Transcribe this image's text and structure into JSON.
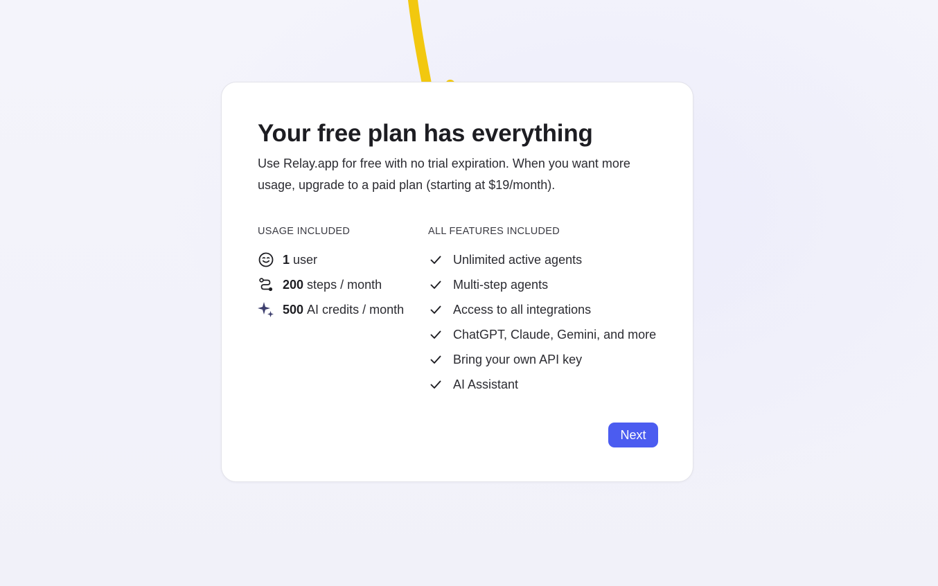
{
  "card": {
    "title": "Your free plan has everything",
    "subtitle": "Use Relay.app for free with no trial expiration. When you want more usage, upgrade to a paid plan (starting at $19/month)."
  },
  "usage": {
    "heading": "USAGE INCLUDED",
    "items": [
      {
        "icon": "smiley-face-icon",
        "number": "1",
        "text": "user"
      },
      {
        "icon": "workflow-steps-icon",
        "number": "200",
        "text": "steps / month"
      },
      {
        "icon": "sparkles-icon",
        "number": "500",
        "text": "AI credits / month"
      }
    ]
  },
  "features": {
    "heading": "ALL FEATURES INCLUDED",
    "items": [
      {
        "icon": "checkmark-icon",
        "text": "Unlimited active agents"
      },
      {
        "icon": "checkmark-icon",
        "text": "Multi-step agents"
      },
      {
        "icon": "checkmark-icon",
        "text": "Access to all integrations"
      },
      {
        "icon": "checkmark-icon",
        "text": "ChatGPT, Claude, Gemini, and more"
      },
      {
        "icon": "checkmark-icon",
        "text": "Bring your own API key"
      },
      {
        "icon": "checkmark-icon",
        "text": "AI Assistant"
      }
    ]
  },
  "actions": {
    "next_label": "Next"
  },
  "colors": {
    "accent": "#4b5cf0",
    "arrow": "#f2c80f",
    "sparkle": "#3d3f6e",
    "background": "#f2f2fa"
  }
}
